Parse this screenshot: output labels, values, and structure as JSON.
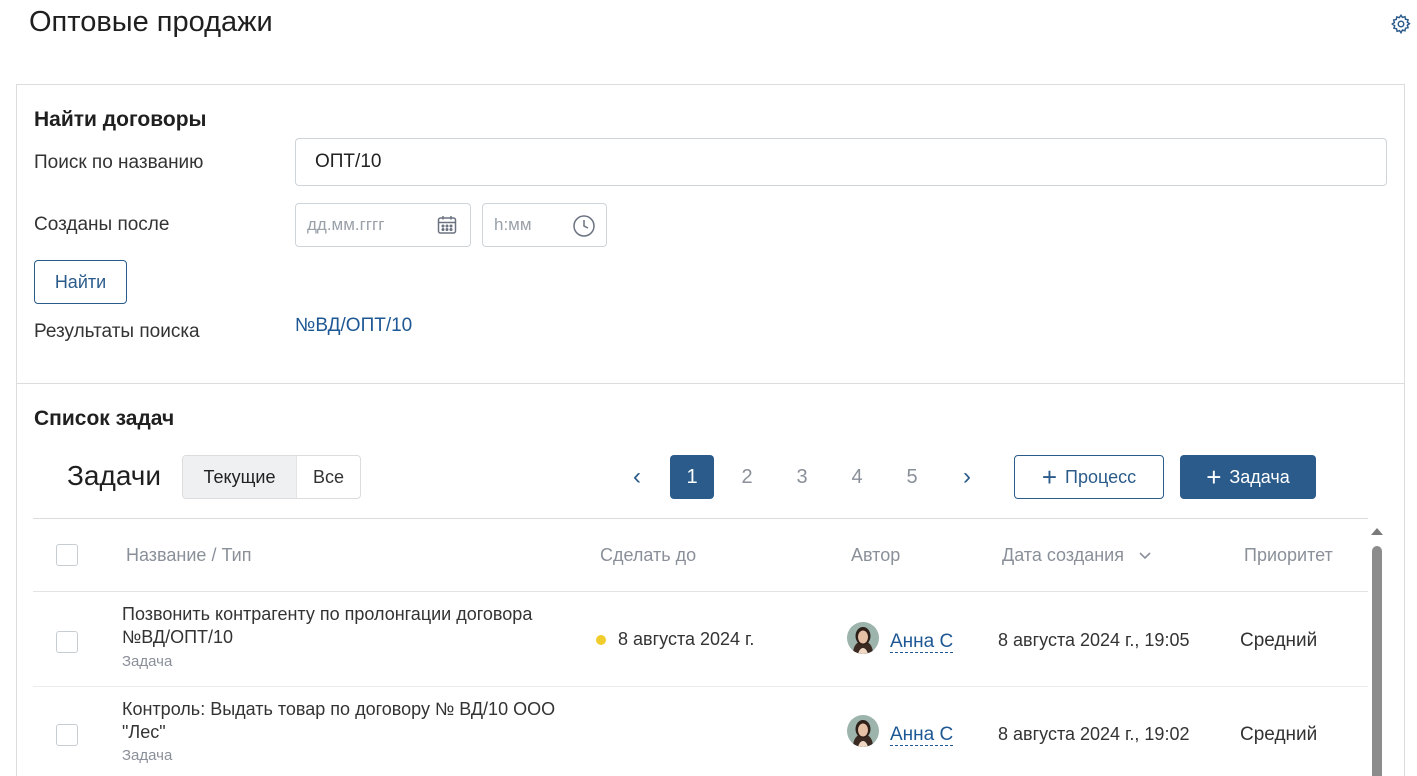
{
  "page": {
    "title": "Оптовые продажи",
    "settings_icon": "gear-icon"
  },
  "search": {
    "section_title": "Найти договоры",
    "name_label": "Поиск по названию",
    "name_value": "ОПТ/10",
    "created_after_label": "Созданы после",
    "date_placeholder": "дд.мм.гггг",
    "time_placeholder": "h:мм",
    "date_icon": "calendar-icon",
    "time_icon": "clock-icon",
    "find_button": "Найти",
    "results_label": "Результаты поиска",
    "result_link": "№ВД/ОПТ/10"
  },
  "tasks": {
    "section_title": "Список задач",
    "heading": "Задачи",
    "filter_current": "Текущие",
    "filter_all": "Все",
    "pagination": {
      "prev": "‹",
      "next": "›",
      "pages": [
        "1",
        "2",
        "3",
        "4",
        "5"
      ],
      "current": "1"
    },
    "process_button": "Процесс",
    "task_button": "Задача",
    "columns": {
      "name": "Название / Тип",
      "due": "Сделать до",
      "author": "Автор",
      "created": "Дата создания",
      "priority": "Приоритет"
    },
    "rows": [
      {
        "name": "Позвонить контрагенту по пролонгации договора №ВД/ОПТ/10",
        "type": "Задача",
        "due": "8 августа 2024 г.",
        "author": "Анна С",
        "created": "8 августа 2024 г., 19:05",
        "priority": "Средний"
      },
      {
        "name": "Контроль: Выдать товар по договору № ВД/10 ООО \"Лес\"",
        "type": "Задача",
        "due": "",
        "author": "Анна С",
        "created": "8 августа 2024 г., 19:02",
        "priority": "Средний"
      }
    ]
  },
  "colors": {
    "primary": "#2b5b8a",
    "link": "#1e5894",
    "due_dot": "#f0cd2b"
  }
}
